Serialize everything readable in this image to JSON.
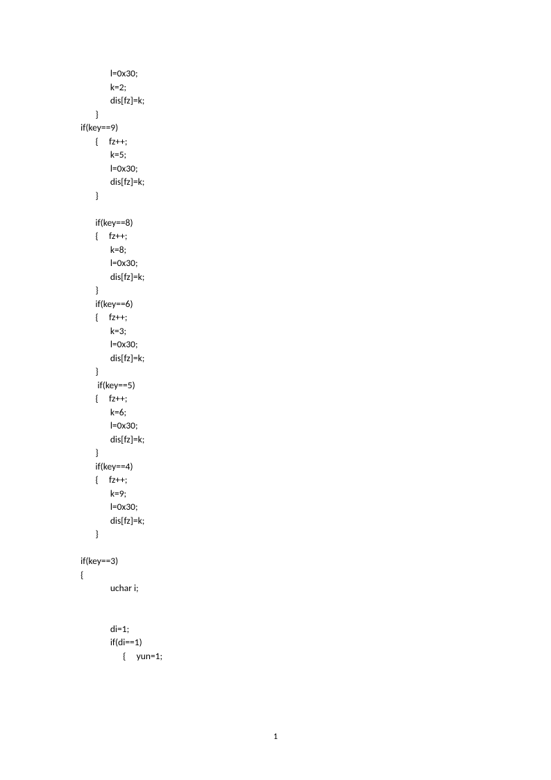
{
  "lines": [
    "                l=0x30;",
    "                k=2;",
    "                dis[fz]=k;",
    "         }",
    "  if(key==9)",
    "         {     fz++;",
    "                k=5;",
    "                l=0x30;",
    "                dis[fz]=k;",
    "         }",
    "",
    "         if(key==8)",
    "         {     fz++;",
    "                k=8;",
    "                l=0x30;",
    "                dis[fz]=k;",
    "         }",
    "         if(key==6)",
    "         {     fz++;",
    "                k=3;",
    "                l=0x30;",
    "                dis[fz]=k;",
    "         }",
    "          if(key==5)",
    "         {     fz++;",
    "                k=6;",
    "                l=0x30;",
    "                dis[fz]=k;",
    "         }",
    "         if(key==4)",
    "         {     fz++;",
    "                k=9;",
    "                l=0x30;",
    "                dis[fz]=k;",
    "         }",
    "",
    "  if(key==3)",
    "  {",
    "                uchar i;",
    "",
    "",
    "                di=1;",
    "                if(di==1)",
    "                      {     yun=1;"
  ],
  "pageNumber": "1"
}
